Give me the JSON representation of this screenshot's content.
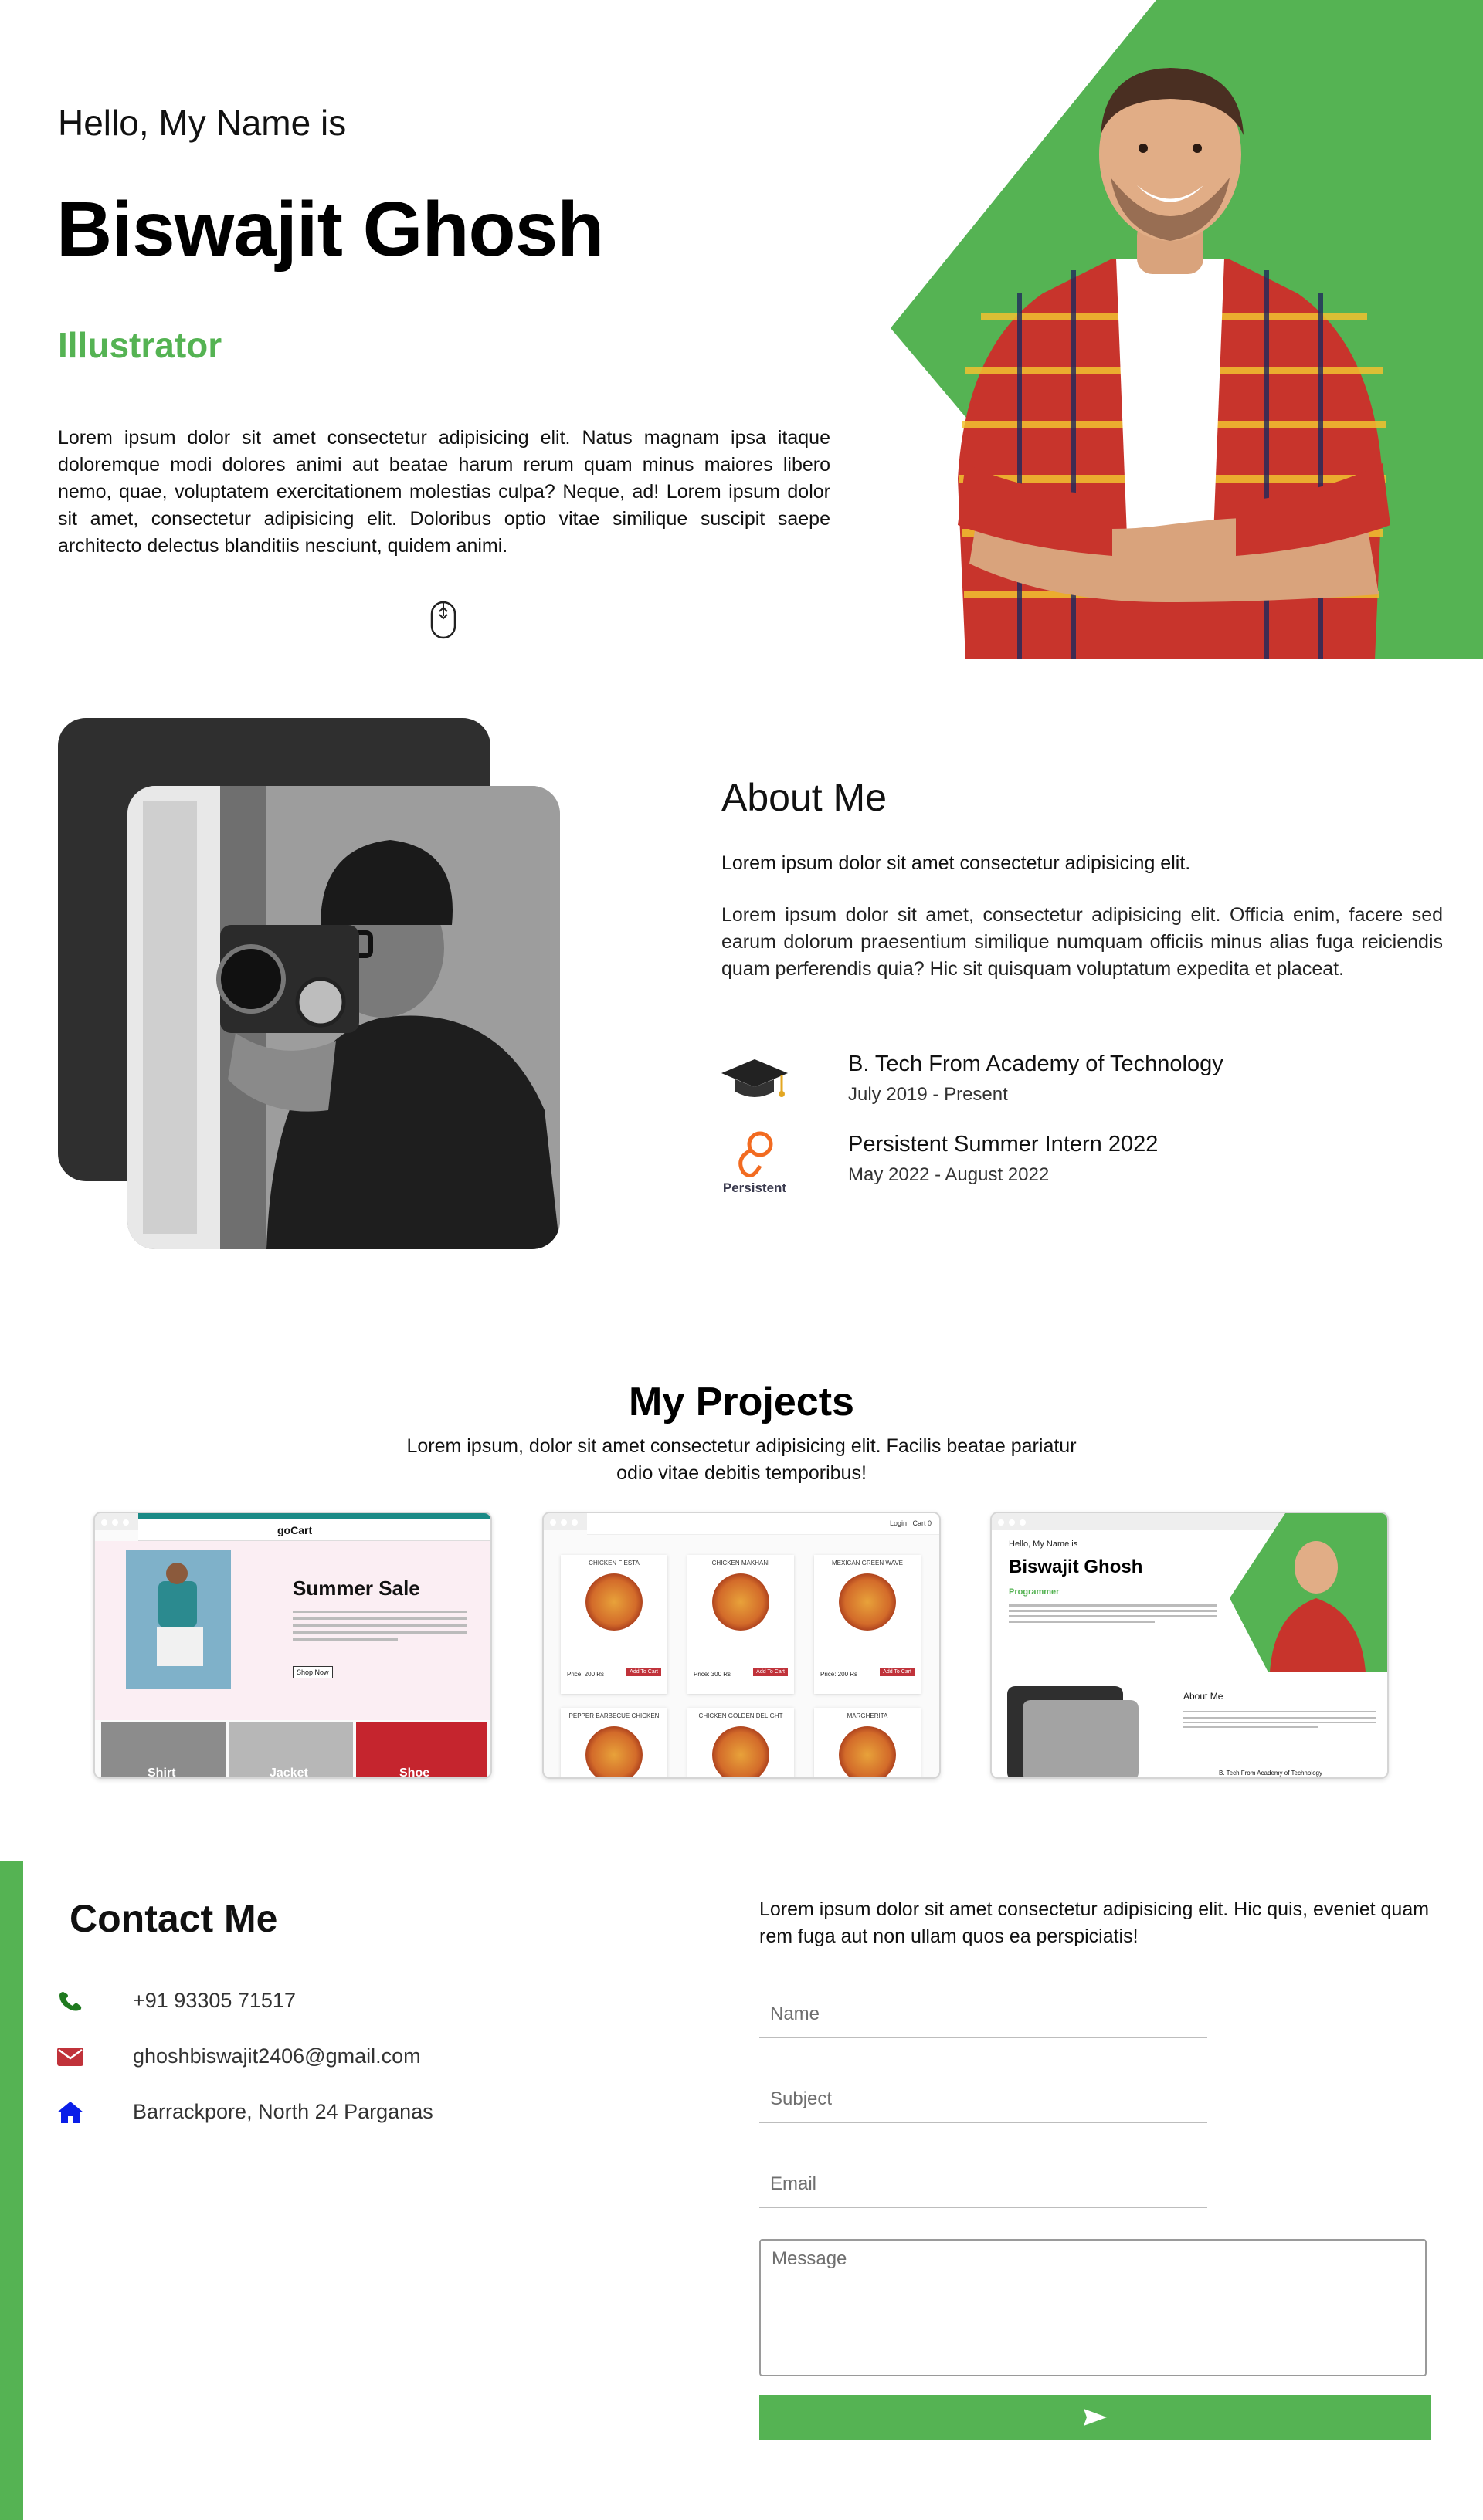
{
  "colors": {
    "accent": "#55b353",
    "dark_card": "#2f2f2f"
  },
  "hero": {
    "greeting": "Hello, My Name is",
    "name": "Biswajit Ghosh",
    "role": "Illustrator",
    "bio": "Lorem ipsum dolor sit amet consectetur adipisicing elit. Natus magnam ipsa itaque doloremque modi dolores animi aut beatae harum rerum quam minus maiores libero nemo, quae, voluptatem exercitationem molestias culpa? Neque, ad! Lorem ipsum dolor sit amet, consectetur adipisicing elit. Doloribus optio vitae similique suscipit saepe architecto delectus blanditiis nesciunt, quidem animi.",
    "scroll_icon": "mouse-scroll-icon"
  },
  "about": {
    "title": "About Me",
    "lead": "Lorem ipsum dolor sit amet consectetur adipisicing elit.",
    "text": "Lorem ipsum dolor sit amet, consectetur adipisicing elit. Officia enim, facere sed earum dolorum praesentium similique numquam officiis minus alias fuga reiciendis quam perferendis quia? Hic sit quisquam voluptatum expedita et placeat.",
    "education": {
      "title": "B. Tech From Academy of Technology",
      "date": "July 2019 - Present",
      "icon": "graduation-cap-icon"
    },
    "work": {
      "title": "Persistent Summer Intern 2022",
      "date": "May 2022 - August 2022",
      "icon": "persistent-logo-icon",
      "logo_text": "Persistent"
    }
  },
  "projects": {
    "title": "My Projects",
    "subtitle": "Lorem ipsum, dolor sit amet consectetur adipisicing elit. Facilis beatae pariatur odio vitae debitis temporibus!",
    "cards": [
      {
        "name": "gocart",
        "brand": "goCart",
        "headline": "Summer Sale",
        "button": "Shop Now",
        "tiles": [
          "Shirt",
          "Jacket",
          "Shoe"
        ]
      },
      {
        "name": "pizza",
        "header_links": "Login   Cart 0",
        "items": [
          "CHICKEN FIESTA",
          "CHICKEN MAKHANI",
          "MEXICAN GREEN WAVE",
          "PEPPER BARBECUE CHICKEN",
          "CHICKEN GOLDEN DELIGHT",
          "MARGHERITA"
        ],
        "prices": [
          "Price: 200 Rs",
          "Price: 300 Rs",
          "Price: 200 Rs"
        ],
        "add_label": "Add To Cart"
      },
      {
        "name": "portfolio",
        "greeting": "Hello, My Name is",
        "headline": "Biswajit Ghosh",
        "role": "Programmer",
        "about": "About Me",
        "edu": "B. Tech From Academy of Technology"
      }
    ]
  },
  "contact": {
    "title": "Contact Me",
    "phone": "+91 93305 71517",
    "email": "ghoshbiswajit2406@gmail.com",
    "address": "Barrackpore, North 24 Parganas",
    "intro": "Lorem ipsum dolor sit amet consectetur adipisicing elit. Hic quis, eveniet quam rem fuga aut non ullam quos ea perspiciatis!",
    "form": {
      "name_placeholder": "Name",
      "subject_placeholder": "Subject",
      "email_placeholder": "Email",
      "message_placeholder": "Message",
      "send_icon": "send-icon"
    }
  }
}
